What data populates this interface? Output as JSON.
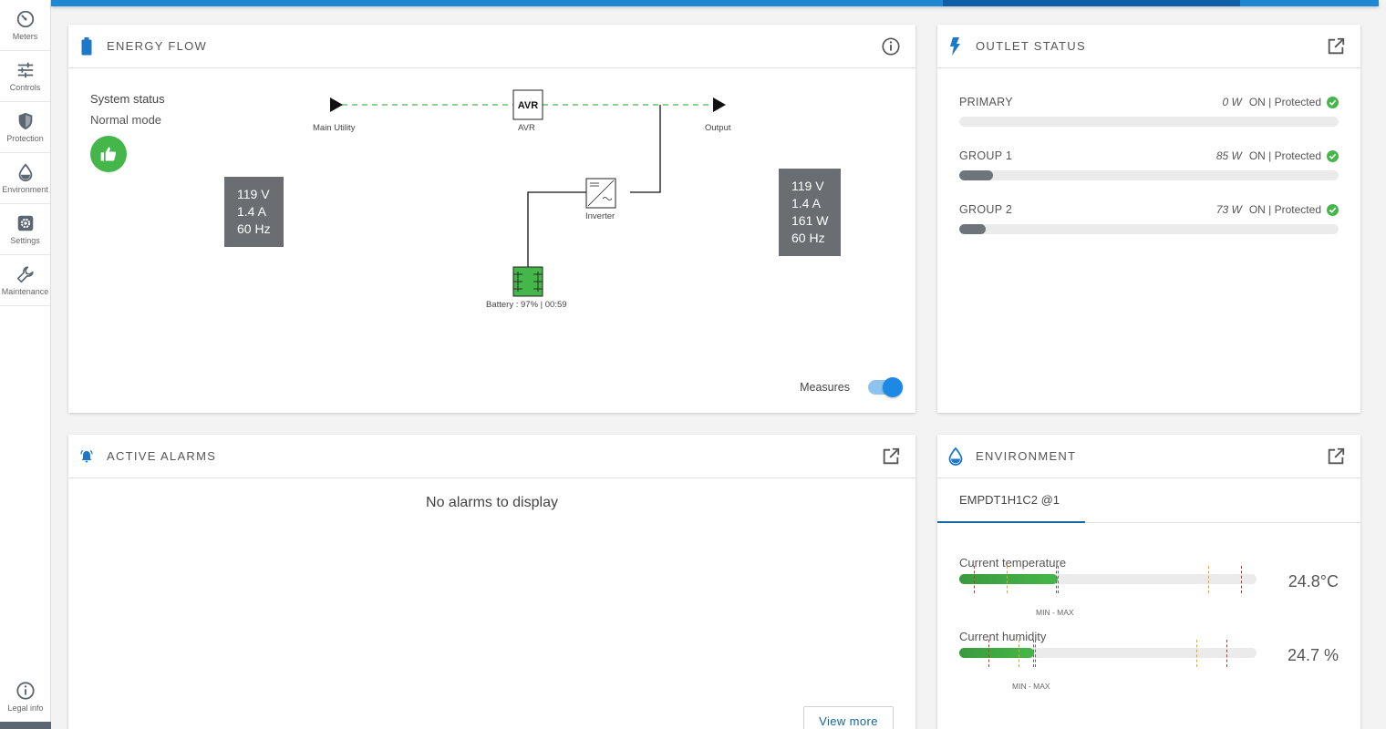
{
  "sidebar": {
    "items": [
      {
        "label": "Meters",
        "icon": "gauge-icon"
      },
      {
        "label": "Controls",
        "icon": "sliders-icon"
      },
      {
        "label": "Protection",
        "icon": "shield-icon"
      },
      {
        "label": "Environment",
        "icon": "droplet-icon"
      },
      {
        "label": "Settings",
        "icon": "gear-icon"
      },
      {
        "label": "Maintenance",
        "icon": "wrench-icon"
      }
    ],
    "legal": "Legal info"
  },
  "energy_flow": {
    "title": "ENERGY FLOW",
    "system_status_label": "System status",
    "system_status_value": "Normal mode",
    "nodes": {
      "main_utility": "Main Utility",
      "avr": "AVR",
      "avr_box": "AVR",
      "output": "Output",
      "inverter": "Inverter",
      "battery": "Battery : 97% | 00:59"
    },
    "input_measures": {
      "voltage": "119 V",
      "current": "1.4 A",
      "frequency": "60 Hz"
    },
    "output_measures": {
      "voltage": "119 V",
      "current": "1.4 A",
      "power": "161 W",
      "frequency": "60 Hz"
    },
    "measures_label": "Measures",
    "measures_on": true,
    "colors": {
      "flow_line": "#45b649",
      "battery": "#45b649",
      "status_ok": "#45b649"
    }
  },
  "outlet_status": {
    "title": "OUTLET STATUS",
    "outlets": [
      {
        "name": "PRIMARY",
        "watts": "0 W",
        "state": "ON | Protected",
        "load": 0
      },
      {
        "name": "GROUP 1",
        "watts": "85 W",
        "state": "ON | Protected",
        "load": 0.09
      },
      {
        "name": "GROUP 2",
        "watts": "73 W",
        "state": "ON | Protected",
        "load": 0.07
      }
    ]
  },
  "active_alarms": {
    "title": "ACTIVE ALARMS",
    "empty_message": "No alarms to display",
    "view_more": "View more"
  },
  "environment": {
    "title": "ENVIRONMENT",
    "tab": "EMPDT1H1C2 @1",
    "sensors": [
      {
        "title": "Current temperature",
        "value": "24.8°C",
        "minmax": "MIN - MAX",
        "level": 0.33
      },
      {
        "title": "Current humidity",
        "value": "24.7 %",
        "minmax": "MIN - MAX",
        "level": 0.25
      }
    ]
  },
  "colors": {
    "accent": "#1e88d4",
    "accent_dark": "#0f5fa8",
    "ok": "#45b649",
    "bar_fill": "#6e747a"
  }
}
